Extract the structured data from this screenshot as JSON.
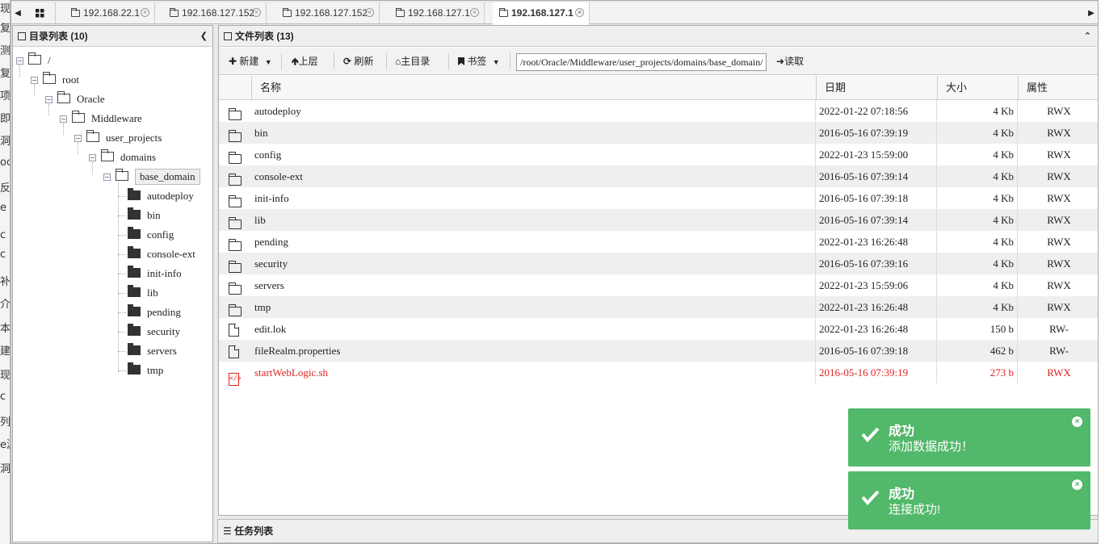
{
  "background_fragments": [
    "现",
    "复",
    "测",
    "复",
    "项",
    "即",
    "洞",
    "oo",
    "反",
    "e",
    "c 信",
    "c S",
    "补",
    "介",
    "本",
    "建",
    "现",
    "c",
    "列",
    "e漏",
    "洞"
  ],
  "tabs": {
    "home_icon": "grid-icon",
    "items": [
      {
        "label": "192.168.22.1",
        "active": false
      },
      {
        "label": "192.168.127.152",
        "active": false
      },
      {
        "label": "192.168.127.152",
        "active": false
      },
      {
        "label": "192.168.127.1",
        "active": false
      },
      {
        "label": "192.168.127.1",
        "active": true
      }
    ]
  },
  "dir_panel": {
    "title": "目录列表 (10)",
    "tree": [
      {
        "label": "/",
        "level": 0,
        "expanded": true
      },
      {
        "label": "root",
        "level": 1,
        "expanded": true
      },
      {
        "label": "Oracle",
        "level": 2,
        "expanded": true
      },
      {
        "label": "Middleware",
        "level": 3,
        "expanded": true
      },
      {
        "label": "user_projects",
        "level": 4,
        "expanded": true
      },
      {
        "label": "domains",
        "level": 5,
        "expanded": true
      },
      {
        "label": "base_domain",
        "level": 6,
        "expanded": true,
        "selected": true
      },
      {
        "label": "autodeploy",
        "level": 7
      },
      {
        "label": "bin",
        "level": 7
      },
      {
        "label": "config",
        "level": 7
      },
      {
        "label": "console-ext",
        "level": 7
      },
      {
        "label": "init-info",
        "level": 7
      },
      {
        "label": "lib",
        "level": 7
      },
      {
        "label": "pending",
        "level": 7
      },
      {
        "label": "security",
        "level": 7
      },
      {
        "label": "servers",
        "level": 7
      },
      {
        "label": "tmp",
        "level": 7
      }
    ]
  },
  "file_panel": {
    "title": "文件列表 (13)",
    "toolbar": {
      "new": "新建",
      "up": "上层",
      "refresh": "刷新",
      "home": "主目录",
      "bookmark": "书签",
      "path": "/root/Oracle/Middleware/user_projects/domains/base_domain/",
      "read": "读取"
    },
    "columns": {
      "name": "名称",
      "date": "日期",
      "size": "大小",
      "attr": "属性"
    },
    "files": [
      {
        "name": "autodeploy",
        "date": "2022-01-22 07:18:56",
        "size": "4 Kb",
        "attr": "RWX",
        "type": "folder"
      },
      {
        "name": "bin",
        "date": "2016-05-16 07:39:19",
        "size": "4 Kb",
        "attr": "RWX",
        "type": "folder"
      },
      {
        "name": "config",
        "date": "2022-01-23 15:59:00",
        "size": "4 Kb",
        "attr": "RWX",
        "type": "folder"
      },
      {
        "name": "console-ext",
        "date": "2016-05-16 07:39:14",
        "size": "4 Kb",
        "attr": "RWX",
        "type": "folder"
      },
      {
        "name": "init-info",
        "date": "2016-05-16 07:39:18",
        "size": "4 Kb",
        "attr": "RWX",
        "type": "folder"
      },
      {
        "name": "lib",
        "date": "2016-05-16 07:39:14",
        "size": "4 Kb",
        "attr": "RWX",
        "type": "folder"
      },
      {
        "name": "pending",
        "date": "2022-01-23 16:26:48",
        "size": "4 Kb",
        "attr": "RWX",
        "type": "folder"
      },
      {
        "name": "security",
        "date": "2016-05-16 07:39:16",
        "size": "4 Kb",
        "attr": "RWX",
        "type": "folder"
      },
      {
        "name": "servers",
        "date": "2022-01-23 15:59:06",
        "size": "4 Kb",
        "attr": "RWX",
        "type": "folder"
      },
      {
        "name": "tmp",
        "date": "2022-01-23 16:26:48",
        "size": "4 Kb",
        "attr": "RWX",
        "type": "folder"
      },
      {
        "name": "edit.lok",
        "date": "2022-01-23 16:26:48",
        "size": "150 b",
        "attr": "RW-",
        "type": "file"
      },
      {
        "name": "fileRealm.properties",
        "date": "2016-05-16 07:39:18",
        "size": "462 b",
        "attr": "RW-",
        "type": "file"
      },
      {
        "name": "startWebLogic.sh",
        "date": "2016-05-16 07:39:19",
        "size": "273 b",
        "attr": "RWX",
        "type": "script"
      }
    ]
  },
  "task_panel": {
    "title": "任务列表"
  },
  "toasts": [
    {
      "title": "成功",
      "message": "添加数据成功！"
    },
    {
      "title": "成功",
      "message": "连接成功!"
    }
  ],
  "colors": {
    "accent_red": "#e32222",
    "toast_green": "#52b86a"
  }
}
